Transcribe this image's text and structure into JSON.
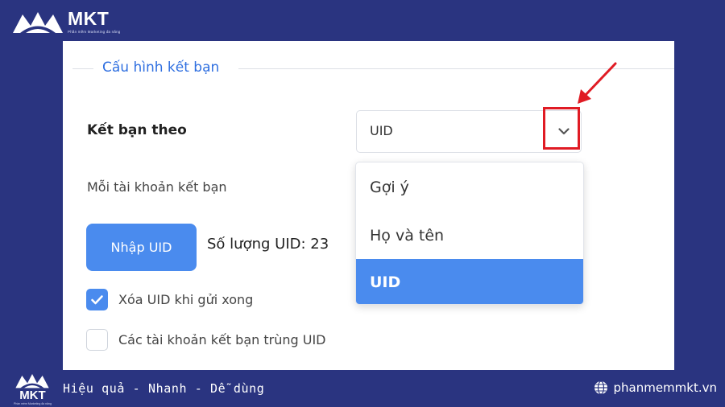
{
  "brand": {
    "name": "MKT",
    "tagline": "Phần mềm Marketing đa năng"
  },
  "form": {
    "section_title": "Cấu hình kết bạn",
    "friend_by_label": "Kết bạn theo",
    "friend_by_value": "UID",
    "per_account_label": "Mỗi tài khoản kết bạn",
    "import_button_label": "Nhập UID",
    "uid_count_text": "Số lượng UID: 23",
    "checkboxes": [
      {
        "label": "Xóa UID khi gửi xong",
        "checked": true
      },
      {
        "label": "Các tài khoản kết bạn trùng UID",
        "checked": false
      }
    ]
  },
  "dropdown": {
    "options": [
      "Gợi ý",
      "Họ và tên",
      "UID"
    ],
    "selected": "UID"
  },
  "footer": {
    "slogan": "Hiệu quả - Nhanh  - Dễ dùng",
    "website": "phanmemmkt.vn"
  },
  "colors": {
    "background": "#2a3480",
    "accent": "#4a8bee",
    "legend": "#2f6fe0",
    "highlight": "#e01b24"
  },
  "icons": [
    "mkt-logo-icon",
    "chevron-down-icon",
    "red-arrow-icon",
    "checkmark-icon",
    "globe-icon"
  ]
}
